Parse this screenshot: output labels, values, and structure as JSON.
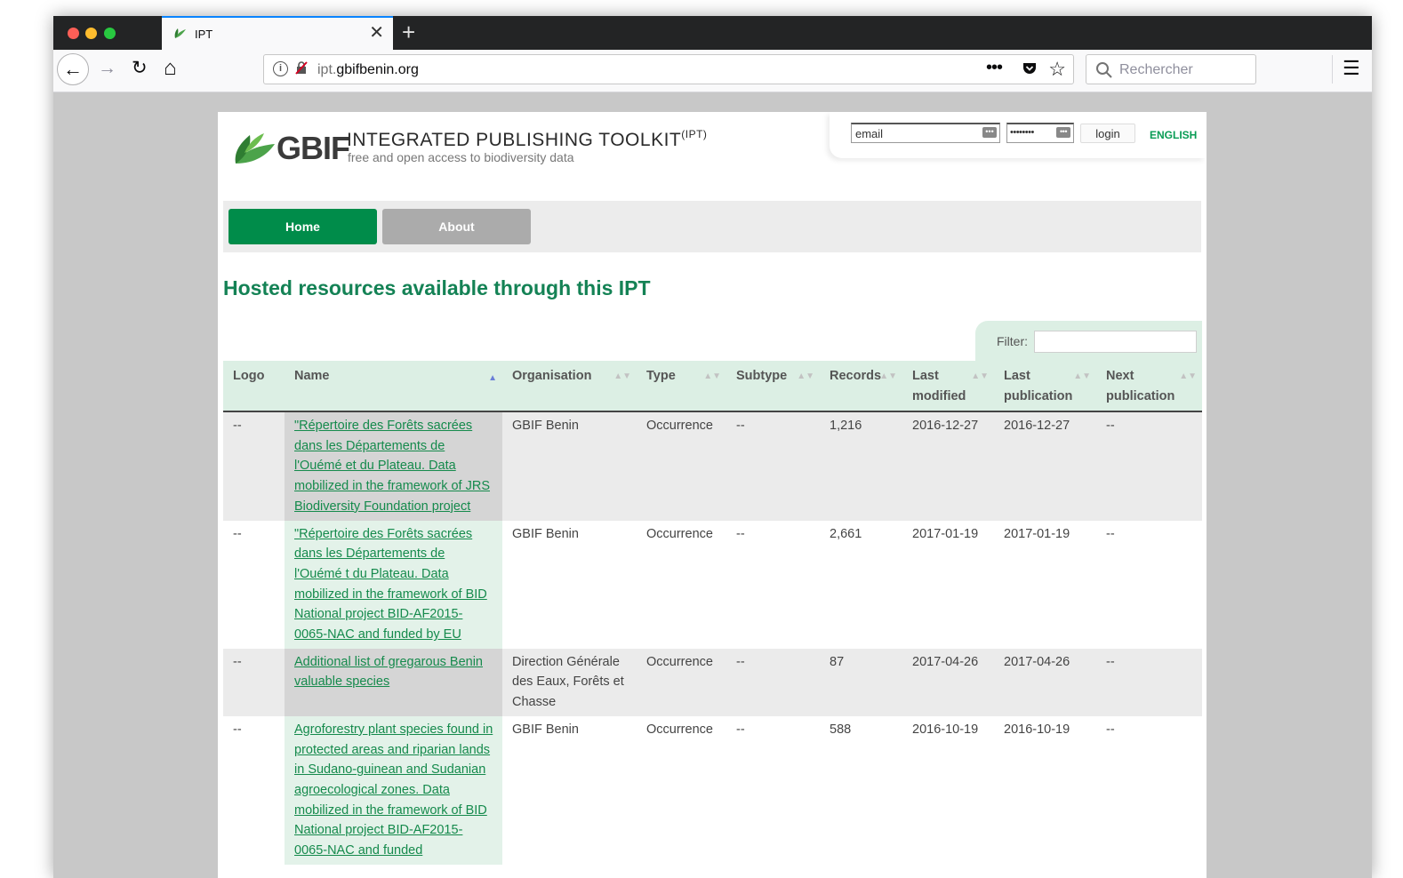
{
  "browser": {
    "tab_title": "IPT",
    "tab_close": "✕",
    "new_tab": "+",
    "url_host_prefix": "ipt.",
    "url_host_domain": "gbifbenin.org",
    "url_more": "•••",
    "search_placeholder": "Rechercher",
    "menu_glyph": "☰",
    "back_glyph": "←",
    "forward_glyph": "→",
    "reload_glyph": "↻",
    "home_glyph": "⌂",
    "star_glyph": "☆",
    "info_glyph": "i",
    "lock_glyph": "🔒"
  },
  "header": {
    "logo_text": "GBIF",
    "title": "INTEGRATED PUBLISHING TOOLKIT",
    "title_sup": "(IPT)",
    "subtitle": "free and open access to biodiversity data"
  },
  "login": {
    "email_value": "email",
    "password_value": "••••••••",
    "key_glyph": "•••",
    "button_label": "login",
    "language": "ENGLISH"
  },
  "menu": {
    "home": "Home",
    "about": "About"
  },
  "main": {
    "title": "Hosted resources available through this IPT",
    "filter_label": "Filter:"
  },
  "table": {
    "sort_glyph": "▲▼",
    "sort_active_glyph": "▲",
    "headers": {
      "logo": "Logo",
      "name": "Name",
      "organisation": "Organisation",
      "type": "Type",
      "subtype": "Subtype",
      "records": "Records",
      "last_modified": "Last modified",
      "last_publication": "Last publication",
      "next_publication": "Next publication"
    },
    "rows": [
      {
        "logo": "--",
        "name": "\"Répertoire des Forêts sacrées dans les Départements de l'Ouémé et du Plateau. Data mobilized in the framework of JRS Biodiversity Foundation project",
        "organisation": "GBIF Benin",
        "type": "Occurrence",
        "subtype": "--",
        "records": "1,216",
        "last_modified": "2016-12-27",
        "last_publication": "2016-12-27",
        "next_publication": "--"
      },
      {
        "logo": "--",
        "name": "\"Répertoire des Forêts sacrées dans les Départements de l'Ouémé t du Plateau. Data mobilized in the framework of BID National project BID-AF2015-0065-NAC and funded by EU",
        "organisation": "GBIF Benin",
        "type": "Occurrence",
        "subtype": "--",
        "records": "2,661",
        "last_modified": "2017-01-19",
        "last_publication": "2017-01-19",
        "next_publication": "--"
      },
      {
        "logo": "--",
        "name": "Additional list of gregarous Benin valuable species",
        "organisation": "Direction Générale des Eaux, Forêts et Chasse",
        "type": "Occurrence",
        "subtype": "--",
        "records": "87",
        "last_modified": "2017-04-26",
        "last_publication": "2017-04-26",
        "next_publication": "--"
      },
      {
        "logo": "--",
        "name": "Agroforestry plant species found in protected areas and riparian lands in Sudano-guinean and Sudanian agroecological zones. Data mobilized in the framework of BID National project BID-AF2015-0065-NAC and funded",
        "organisation": "GBIF Benin",
        "type": "Occurrence",
        "subtype": "--",
        "records": "588",
        "last_modified": "2016-10-19",
        "last_publication": "2016-10-19",
        "next_publication": "--"
      }
    ]
  },
  "colors": {
    "gbif_green": "#148255",
    "button_green": "#008c4a",
    "header_bg": "#dcefe4"
  }
}
